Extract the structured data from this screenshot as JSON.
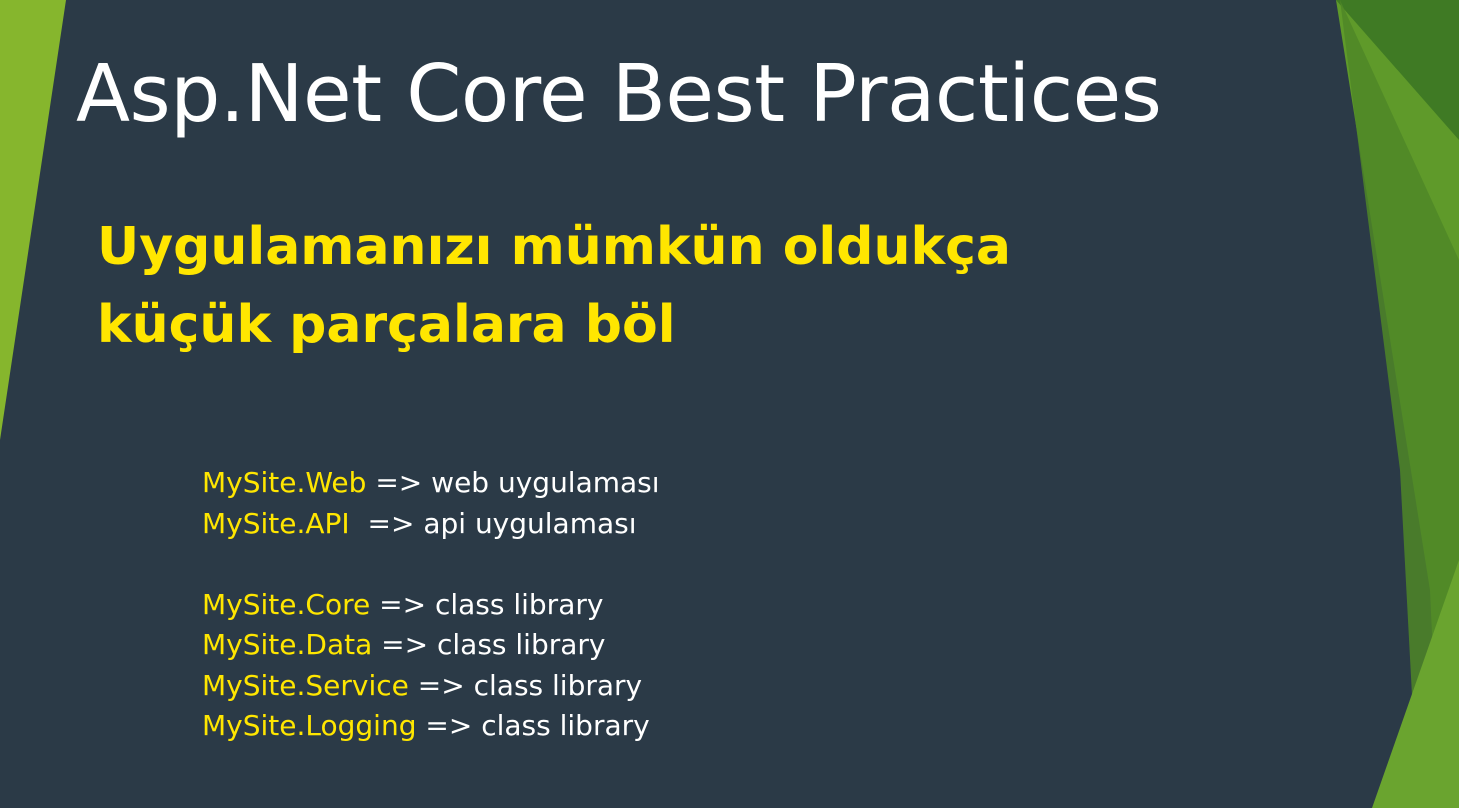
{
  "slide": {
    "title": "Asp.Net Core Best Practices",
    "subtitle_lines": [
      "Uygulamanızı mümkün oldukça",
      "küçük parçalara böl"
    ],
    "projects": [
      {
        "name": "MySite.Web",
        "arrow": "=>",
        "desc": "web uygulaması"
      },
      {
        "name": "MySite.API",
        "arrow": "=>",
        "desc": "api uygulaması"
      },
      {
        "name": "MySite.Core",
        "arrow": "=>",
        "desc": "class library"
      },
      {
        "name": "MySite.Data",
        "arrow": "=>",
        "desc": "class library"
      },
      {
        "name": "MySite.Service",
        "arrow": "=>",
        "desc": "class library"
      },
      {
        "name": "MySite.Logging",
        "arrow": "=>",
        "desc": "class library"
      }
    ]
  },
  "colors": {
    "background": "#2b3a47",
    "title": "#ffffff",
    "accent_yellow": "#ffe600",
    "green_light": "#86b62d",
    "green_dark": "#3f7a24"
  }
}
